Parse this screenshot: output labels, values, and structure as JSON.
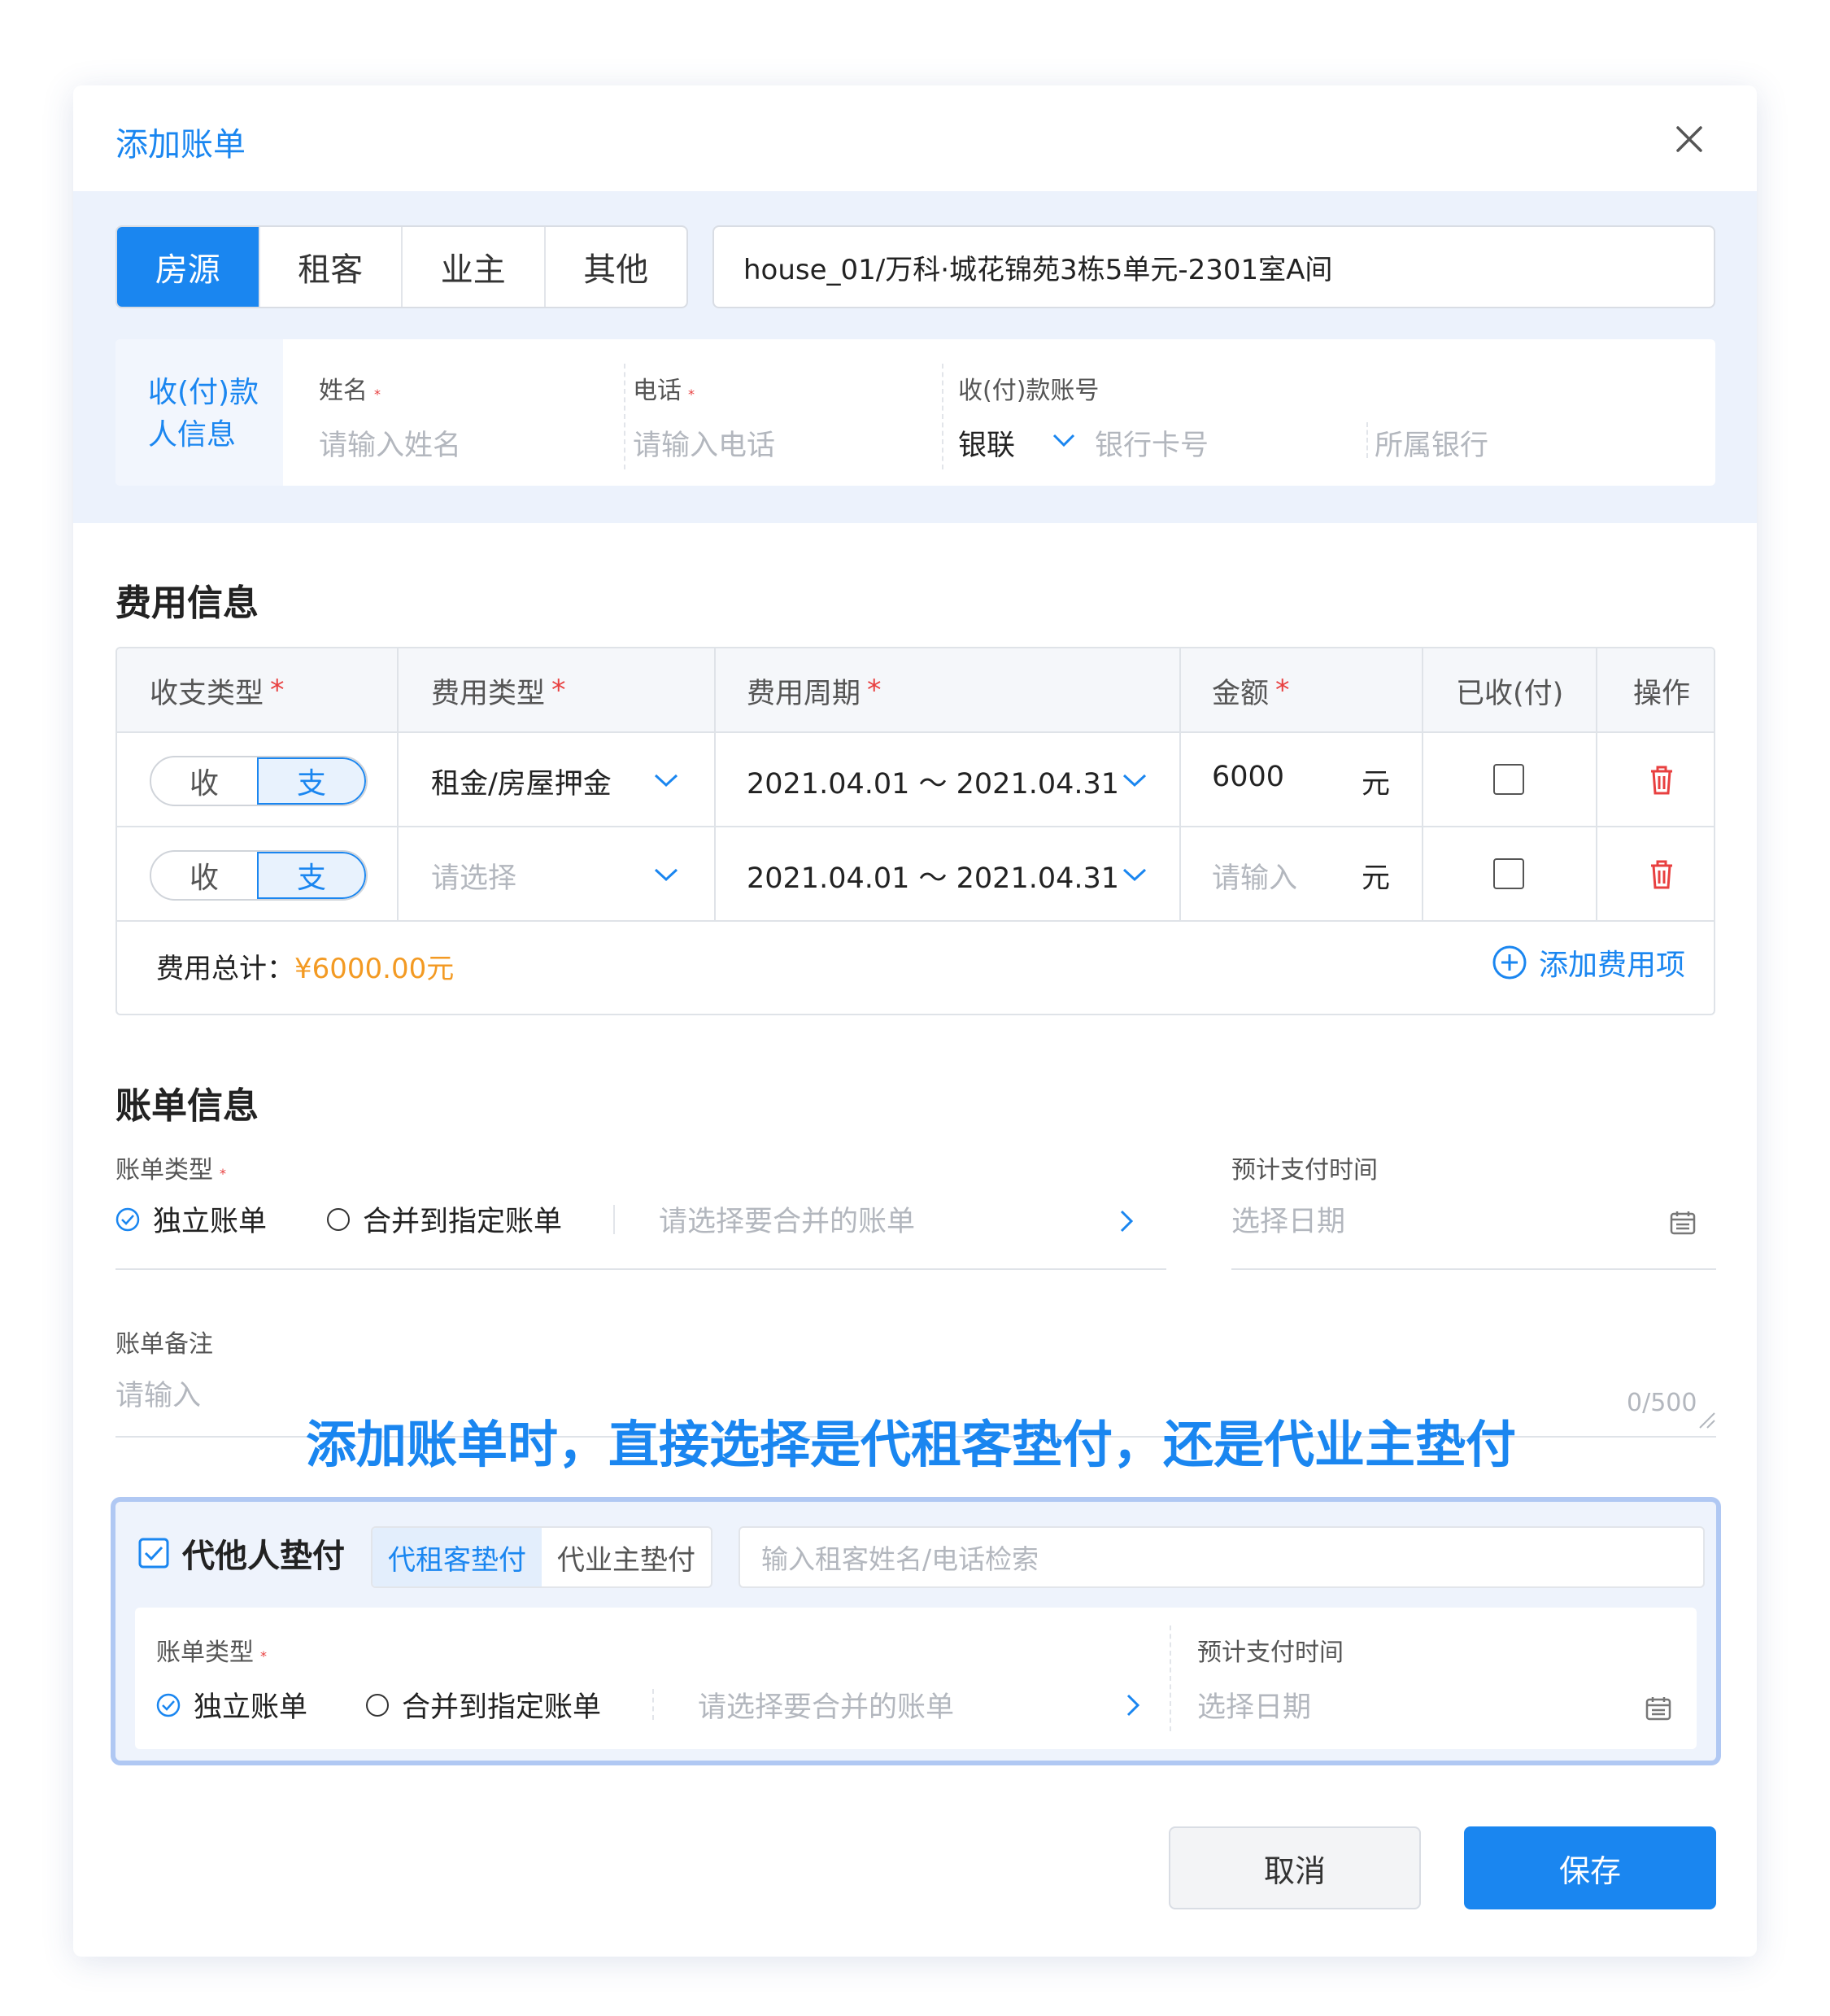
{
  "dialog": {
    "title": "添加账单"
  },
  "tabs": [
    {
      "label": "房源",
      "active": true
    },
    {
      "label": "租客",
      "active": false
    },
    {
      "label": "业主",
      "active": false
    },
    {
      "label": "其他",
      "active": false
    }
  ],
  "house_address": "house_01/万科·城花锦苑3栋5单元-2301室A间",
  "payee": {
    "section_label": [
      "收(付)款",
      "人信息"
    ],
    "name_label": "姓名",
    "name_placeholder": "请输入姓名",
    "phone_label": "电话",
    "phone_placeholder": "请输入电话",
    "account_label": "收(付)款账号",
    "account_type": "银联",
    "card_placeholder": "银行卡号",
    "bank_placeholder": "所属银行"
  },
  "fees": {
    "section_title": "费用信息",
    "headers": [
      "收支类型",
      "费用类型",
      "费用周期",
      "金额",
      "已收(付)",
      "操作"
    ],
    "rows": [
      {
        "in_label": "收",
        "out_label": "支",
        "fee_type": "租金/房屋押金",
        "fee_type_is_placeholder": false,
        "period": "2021.04.01 ～ 2021.04.31",
        "amount": "6000",
        "amount_is_placeholder": false,
        "unit": "元",
        "paid": false
      },
      {
        "in_label": "收",
        "out_label": "支",
        "fee_type": "请选择",
        "fee_type_is_placeholder": true,
        "period": "2021.04.01 ～ 2021.04.31",
        "amount": "请输入",
        "amount_is_placeholder": true,
        "unit": "元",
        "paid": false
      }
    ],
    "total_label": "费用总计：",
    "total_amount": "¥6000.00元",
    "add_label": "添加费用项"
  },
  "bill": {
    "section_title": "账单信息",
    "type_label": "账单类型",
    "option_independent": "独立账单",
    "option_merge": "合并到指定账单",
    "merge_placeholder": "请选择要合并的账单",
    "date_label": "预计支付时间",
    "date_placeholder": "选择日期",
    "remark_label": "账单备注",
    "remark_placeholder": "请输入",
    "remark_counter": "0/500"
  },
  "annotation": "添加账单时，直接选择是代租客垫付，还是代业主垫付",
  "proxy": {
    "checkbox_label": "代他人垫付",
    "checked": true,
    "tab_tenant": "代租客垫付",
    "tab_owner": "代业主垫付",
    "search_placeholder": "输入租客姓名/电话检索",
    "type_label": "账单类型",
    "option_independent": "独立账单",
    "option_merge": "合并到指定账单",
    "merge_placeholder": "请选择要合并的账单",
    "date_label": "预计支付时间",
    "date_placeholder": "选择日期"
  },
  "actions": {
    "cancel": "取消",
    "save": "保存"
  },
  "colors": {
    "primary": "#1a86f0",
    "amount": "#f39a23",
    "required": "#e84040",
    "delete": "#e84040"
  },
  "icons": [
    "close-icon",
    "chevron-down-icon",
    "trash-icon",
    "plus-circle-icon",
    "check-circle-icon",
    "chevron-right-icon",
    "calendar-icon",
    "checkbox-checked-icon"
  ]
}
